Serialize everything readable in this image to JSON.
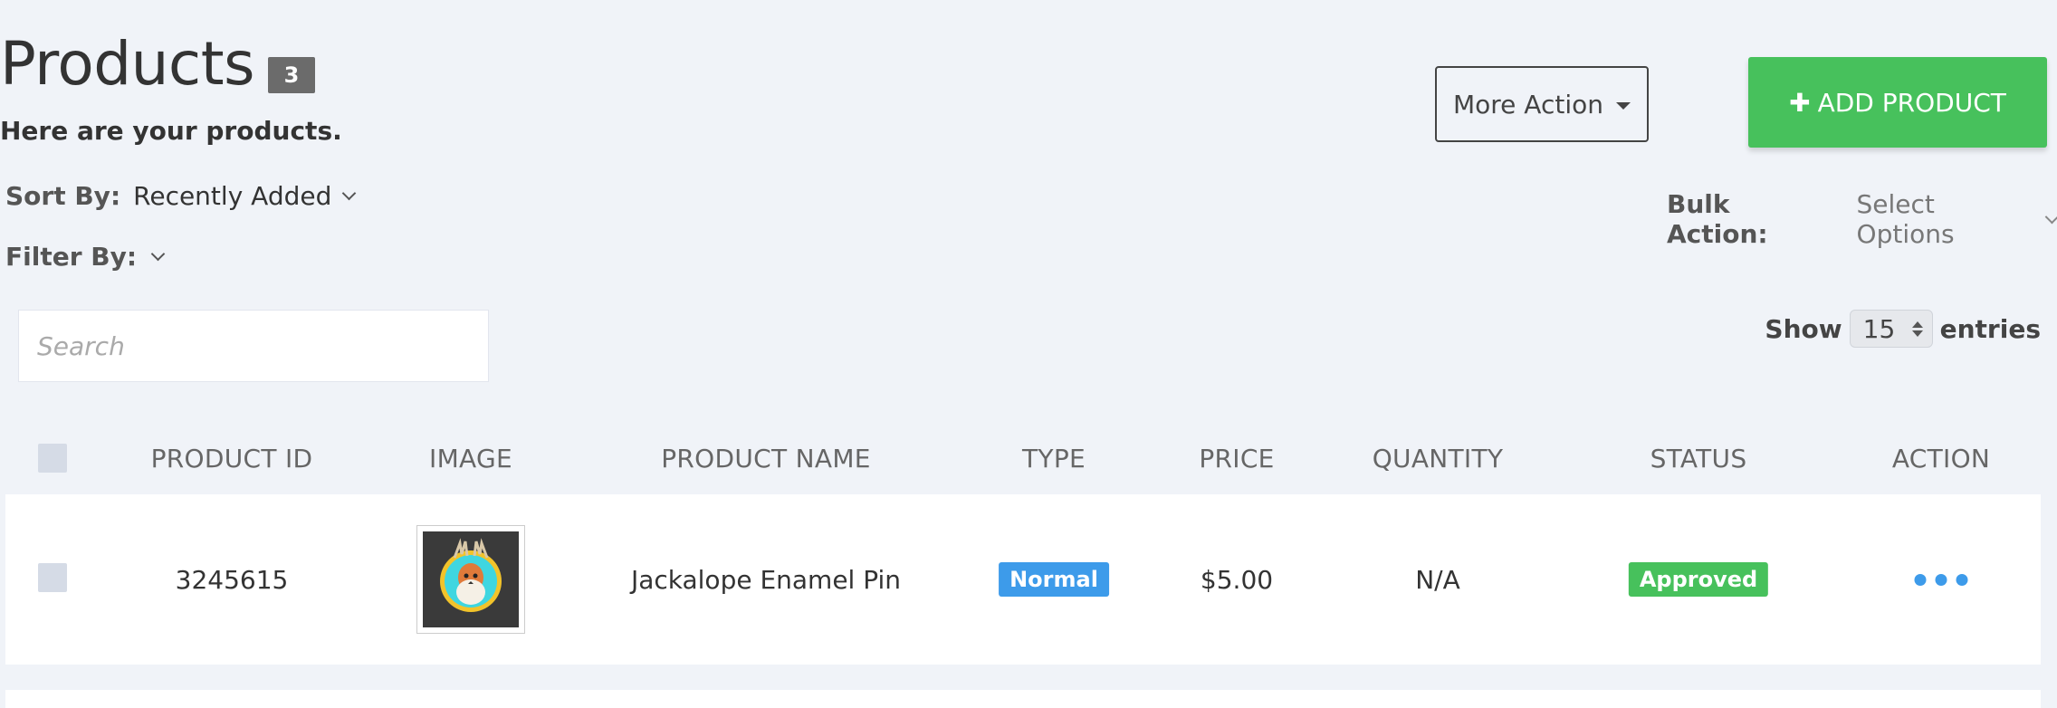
{
  "header": {
    "title": "Products",
    "count": "3",
    "subtitle": "Here are your products.",
    "more_action_label": "More Action",
    "add_product_label": "ADD PRODUCT",
    "add_product_color": "#47c15c"
  },
  "controls": {
    "sort_label": "Sort By:",
    "sort_value": "Recently Added",
    "filter_label": "Filter By:",
    "bulk_label": "Bulk Action:",
    "bulk_value": "Select Options",
    "search_placeholder": "Search",
    "show_label": "Show",
    "entries_value": "15",
    "entries_label": "entries"
  },
  "table": {
    "columns": [
      "PRODUCT ID",
      "IMAGE",
      "PRODUCT NAME",
      "TYPE",
      "PRICE",
      "QUANTITY",
      "STATUS",
      "ACTION"
    ],
    "rows": [
      {
        "product_id": "3245615",
        "image": "jackalope-pin-image",
        "product_name": "Jackalope Enamel Pin",
        "type": "Normal",
        "type_color": "#3d9bea",
        "price": "$5.00",
        "quantity": "N/A",
        "status": "Approved",
        "status_color": "#47c15c"
      }
    ]
  }
}
